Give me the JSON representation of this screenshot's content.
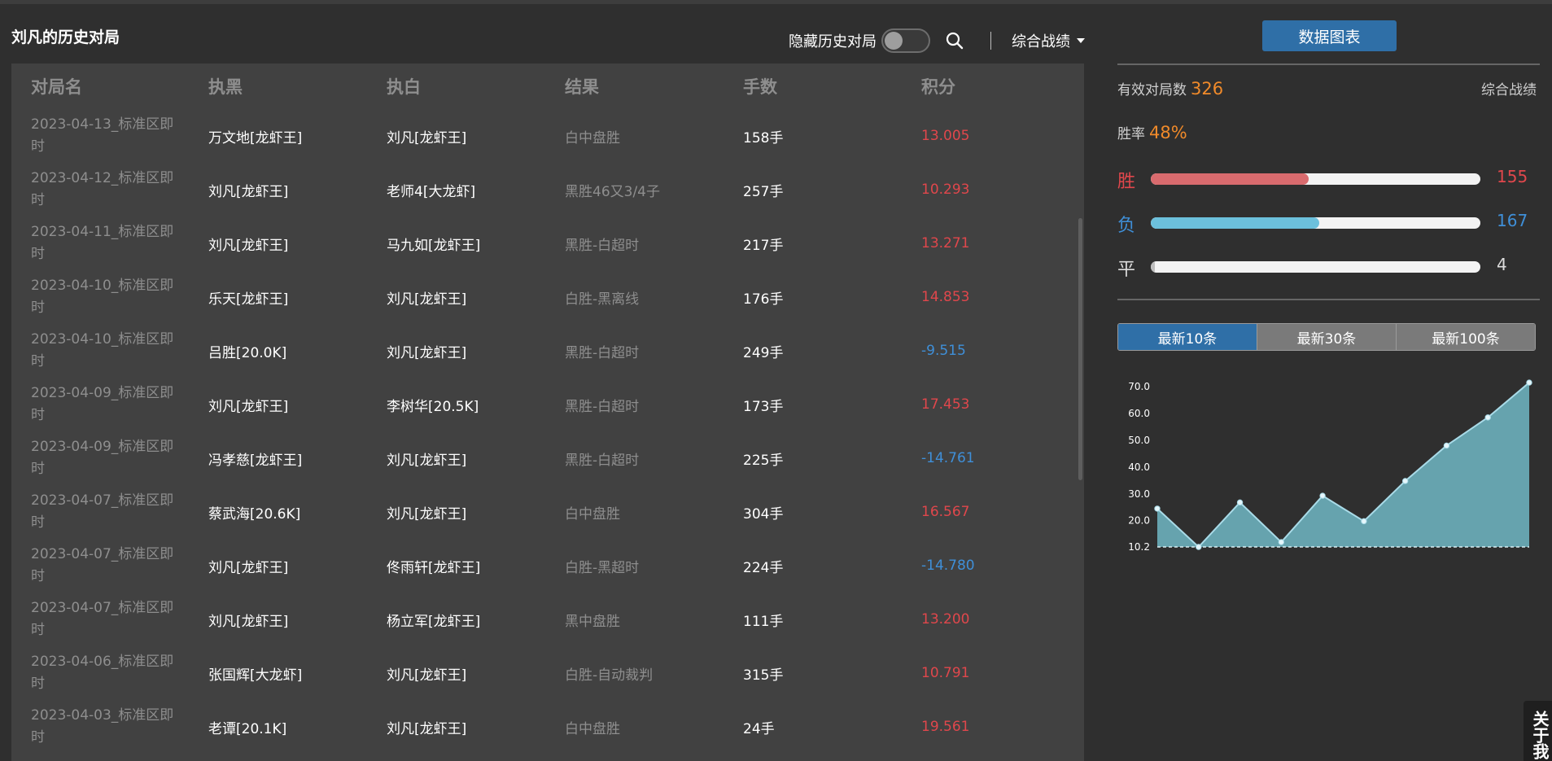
{
  "title": "刘凡的历史对局",
  "toolbar": {
    "hide_history_label": "隐藏历史对局",
    "dropdown_label": "综合战绩"
  },
  "table": {
    "headers": [
      "对局名",
      "执黑",
      "执白",
      "结果",
      "手数",
      "积分"
    ],
    "rows": [
      {
        "name": "2023-04-13_标准区即时",
        "black": "万文地[龙虾王]",
        "white": "刘凡[龙虾王]",
        "result": "白中盘胜",
        "moves": "158手",
        "score": "13.005",
        "sign": "pos"
      },
      {
        "name": "2023-04-12_标准区即时",
        "black": "刘凡[龙虾王]",
        "white": "老师4[大龙虾]",
        "result": "黑胜46又3/4子",
        "moves": "257手",
        "score": "10.293",
        "sign": "pos"
      },
      {
        "name": "2023-04-11_标准区即时",
        "black": "刘凡[龙虾王]",
        "white": "马九如[龙虾王]",
        "result": "黑胜-白超时",
        "moves": "217手",
        "score": "13.271",
        "sign": "pos"
      },
      {
        "name": "2023-04-10_标准区即时",
        "black": "乐天[龙虾王]",
        "white": "刘凡[龙虾王]",
        "result": "白胜-黑离线",
        "moves": "176手",
        "score": "14.853",
        "sign": "pos"
      },
      {
        "name": "2023-04-10_标准区即时",
        "black": "吕胜[20.0K]",
        "white": "刘凡[龙虾王]",
        "result": "黑胜-白超时",
        "moves": "249手",
        "score": "-9.515",
        "sign": "neg"
      },
      {
        "name": "2023-04-09_标准区即时",
        "black": "刘凡[龙虾王]",
        "white": "李树华[20.5K]",
        "result": "黑胜-白超时",
        "moves": "173手",
        "score": "17.453",
        "sign": "pos"
      },
      {
        "name": "2023-04-09_标准区即时",
        "black": "冯孝慈[龙虾王]",
        "white": "刘凡[龙虾王]",
        "result": "黑胜-白超时",
        "moves": "225手",
        "score": "-14.761",
        "sign": "neg"
      },
      {
        "name": "2023-04-07_标准区即时",
        "black": "蔡武海[20.6K]",
        "white": "刘凡[龙虾王]",
        "result": "白中盘胜",
        "moves": "304手",
        "score": "16.567",
        "sign": "pos"
      },
      {
        "name": "2023-04-07_标准区即时",
        "black": "刘凡[龙虾王]",
        "white": "佟雨轩[龙虾王]",
        "result": "白胜-黑超时",
        "moves": "224手",
        "score": "-14.780",
        "sign": "neg"
      },
      {
        "name": "2023-04-07_标准区即时",
        "black": "刘凡[龙虾王]",
        "white": "杨立军[龙虾王]",
        "result": "黑中盘胜",
        "moves": "111手",
        "score": "13.200",
        "sign": "pos"
      },
      {
        "name": "2023-04-06_标准区即时",
        "black": "张国辉[大龙虾]",
        "white": "刘凡[龙虾王]",
        "result": "白胜-自动裁判",
        "moves": "315手",
        "score": "10.791",
        "sign": "pos"
      },
      {
        "name": "2023-04-03_标准区即时",
        "black": "老谭[20.1K]",
        "white": "刘凡[龙虾王]",
        "result": "白中盘胜",
        "moves": "24手",
        "score": "19.561",
        "sign": "pos"
      }
    ]
  },
  "side": {
    "chart_button": "数据图表",
    "valid_games_label": "有效对局数",
    "valid_games_value": "326",
    "overall_label": "综合战绩",
    "win_rate_label": "胜率",
    "win_rate_value": "48%",
    "bars": [
      {
        "label": "胜",
        "count": "155",
        "fraction": 0.48,
        "color": "#d96b6e",
        "label_color": "#e0474c"
      },
      {
        "label": "负",
        "count": "167",
        "fraction": 0.51,
        "color": "#6cc0dc",
        "label_color": "#3f8fd8"
      },
      {
        "label": "平",
        "count": "4",
        "fraction": 0.012,
        "color": "#bdbdbd",
        "label_color": "#dddddd"
      }
    ],
    "tabs": [
      {
        "label": "最新10条",
        "active": true
      },
      {
        "label": "最新30条",
        "active": false
      },
      {
        "label": "最新100条",
        "active": false
      }
    ],
    "about_label": "关于我"
  },
  "chart_data": {
    "type": "area",
    "y_ticks": [
      "70.0",
      "60.0",
      "50.0",
      "40.0",
      "30.0",
      "20.0",
      "10.2"
    ],
    "ylim": [
      10.2,
      70.0
    ],
    "values": [
      24.5,
      10.2,
      26.8,
      12.0,
      29.3,
      19.8,
      34.8,
      48.0,
      58.5,
      71.5
    ],
    "grid": false,
    "colors": {
      "fill": "#66a3ae",
      "line": "#a9dbe8",
      "point": "#e6f6fb"
    }
  }
}
